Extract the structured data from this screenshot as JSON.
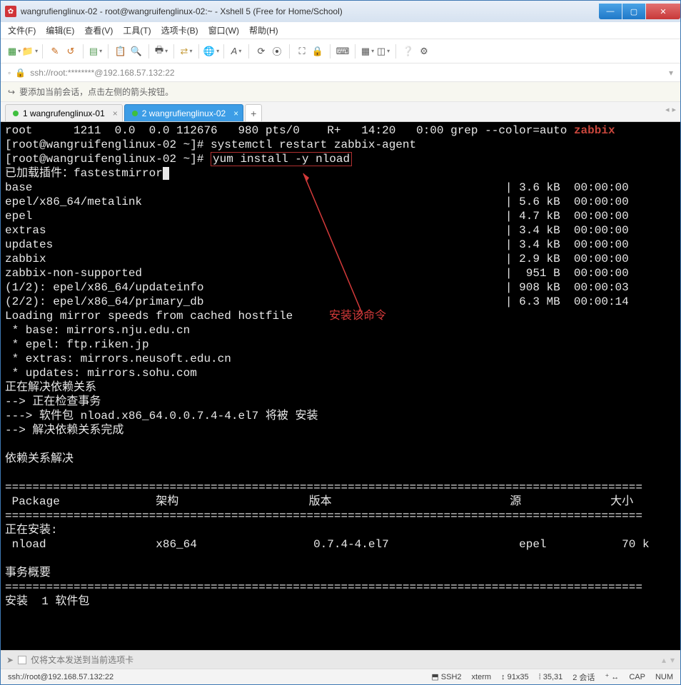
{
  "window": {
    "title": "wangrufienglinux-02 - root@wangruifenglinux-02:~ - Xshell 5 (Free for Home/School)"
  },
  "menu": {
    "file": "文件(F)",
    "edit": "编辑(E)",
    "view": "查看(V)",
    "tools": "工具(T)",
    "tabs": "选项卡(B)",
    "window": "窗口(W)",
    "help": "帮助(H)"
  },
  "address": {
    "text": "ssh://root:********@192.168.57.132:22"
  },
  "infobar": {
    "text": "要添加当前会话，点击左侧的箭头按钮。"
  },
  "tabs": {
    "t1": "1 wangrufenglinux-01",
    "t2": "2 wangrufienglinux-02"
  },
  "term": {
    "l1a": "root      1211  0.0  0.0 112676   980 pts/0    R+   14:20   0:00 grep --color=auto ",
    "l1b": "zabbix",
    "l2": "[root@wangruifenglinux-02 ~]# systemctl restart zabbix-agent",
    "l3a": "[root@wangruifenglinux-02 ~]# ",
    "l3b": "yum install -y nload",
    "l4": "已加载插件：fastestmirror",
    "l5": "base                                                                     | 3.6 kB  00:00:00",
    "l6": "epel/x86_64/metalink                                                     | 5.6 kB  00:00:00",
    "l7": "epel                                                                     | 4.7 kB  00:00:00",
    "l8": "extras                                                                   | 3.4 kB  00:00:00",
    "l9": "updates                                                                  | 3.4 kB  00:00:00",
    "l10": "zabbix                                                                   | 2.9 kB  00:00:00",
    "l11": "zabbix-non-supported                                                     |  951 B  00:00:00",
    "l12": "(1/2): epel/x86_64/updateinfo                                            | 908 kB  00:00:03",
    "l13": "(2/2): epel/x86_64/primary_db                                            | 6.3 MB  00:00:14",
    "l14": "Loading mirror speeds from cached hostfile",
    "l15": " * base: mirrors.nju.edu.cn",
    "l16": " * epel: ftp.riken.jp",
    "l17": " * extras: mirrors.neusoft.edu.cn",
    "l18": " * updates: mirrors.sohu.com",
    "l19": "正在解决依赖关系",
    "l20": "--> 正在检查事务",
    "l21": "---> 软件包 nload.x86_64.0.0.7.4-4.el7 将被 安装",
    "l22": "--> 解决依赖关系完成",
    "l23": "",
    "l24": "依赖关系解决",
    "l25": "",
    "l26": "=============================================================================================",
    "l27": " Package              架构                   版本                          源             大小",
    "l28": "=============================================================================================",
    "l29": "正在安装:",
    "l30": " nload                x86_64                 0.7.4-4.el7                   epel           70 k",
    "l31": "",
    "l32": "事务概要",
    "l33": "=============================================================================================",
    "l34": "安装  1 软件包",
    "annotation": "安装该命令"
  },
  "inputbar": {
    "placeholder": "仅将文本发送到当前选项卡"
  },
  "status": {
    "conn": "ssh://root@192.168.57.132:22",
    "s1": "SSH2",
    "s2": "xterm",
    "s3": "91x35",
    "s4": "35,31",
    "s5": "2 会话",
    "s6": "CAP",
    "s7": "NUM"
  }
}
